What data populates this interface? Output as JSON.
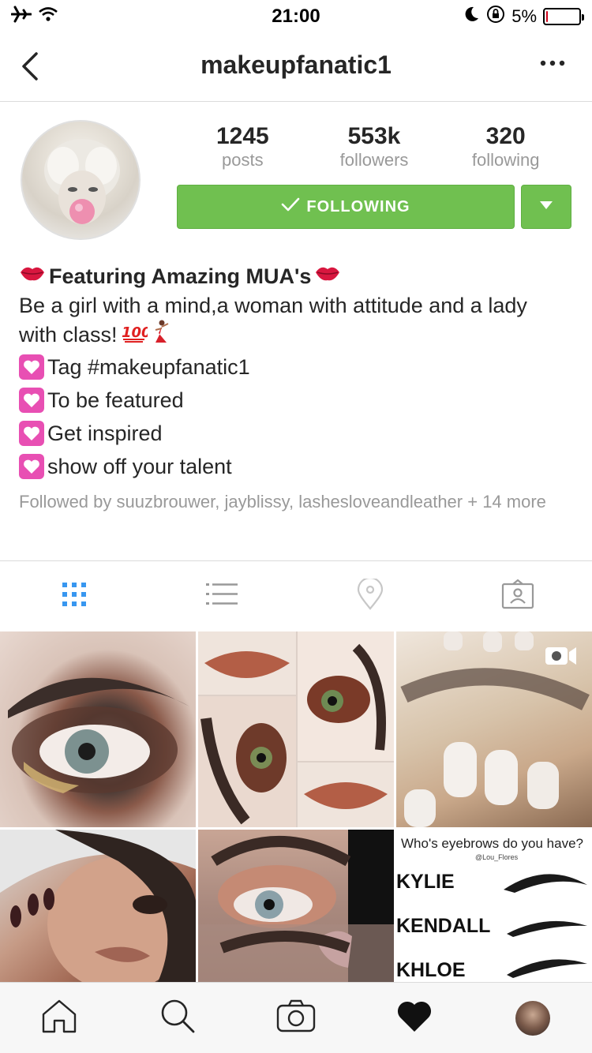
{
  "status_bar": {
    "time": "21:00",
    "battery_percent_text": "5%",
    "battery_level": 0.05,
    "icons": [
      "airplane-icon",
      "wifi-icon",
      "do-not-disturb-icon",
      "rotation-lock-icon",
      "battery-icon"
    ]
  },
  "navbar": {
    "title": "makeupfanatic1",
    "icons": [
      "back-icon",
      "more-icon"
    ]
  },
  "profile": {
    "stats": [
      {
        "value": "1245",
        "label": "posts"
      },
      {
        "value": "553k",
        "label": "followers"
      },
      {
        "value": "320",
        "label": "following"
      }
    ],
    "follow_button_label": "FOLLOWING",
    "button_color": "#70c050"
  },
  "bio": {
    "name": "Featuring Amazing MUA's",
    "text_line1": "Be a girl with a mind,a woman with attitude and a lady",
    "text_line2": "with class!",
    "items": [
      "Tag #makeupfanatic1",
      "To be featured",
      "Get inspired",
      "show off your talent"
    ],
    "followed_by": "Followed by suuzbrouwer, jayblissy, lashesloveandleather + 14 more"
  },
  "tabs": [
    "grid-icon",
    "list-icon",
    "location-icon",
    "tagged-icon"
  ],
  "grid": {
    "post6": {
      "question": "Who's eyebrows do you have?",
      "credit": "@Lou_Flores",
      "names": [
        "KYLIE",
        "KENDALL",
        "KHLOE"
      ]
    }
  },
  "bottom_nav": [
    "home-icon",
    "search-icon",
    "camera-icon",
    "heart-icon",
    "profile-avatar"
  ]
}
